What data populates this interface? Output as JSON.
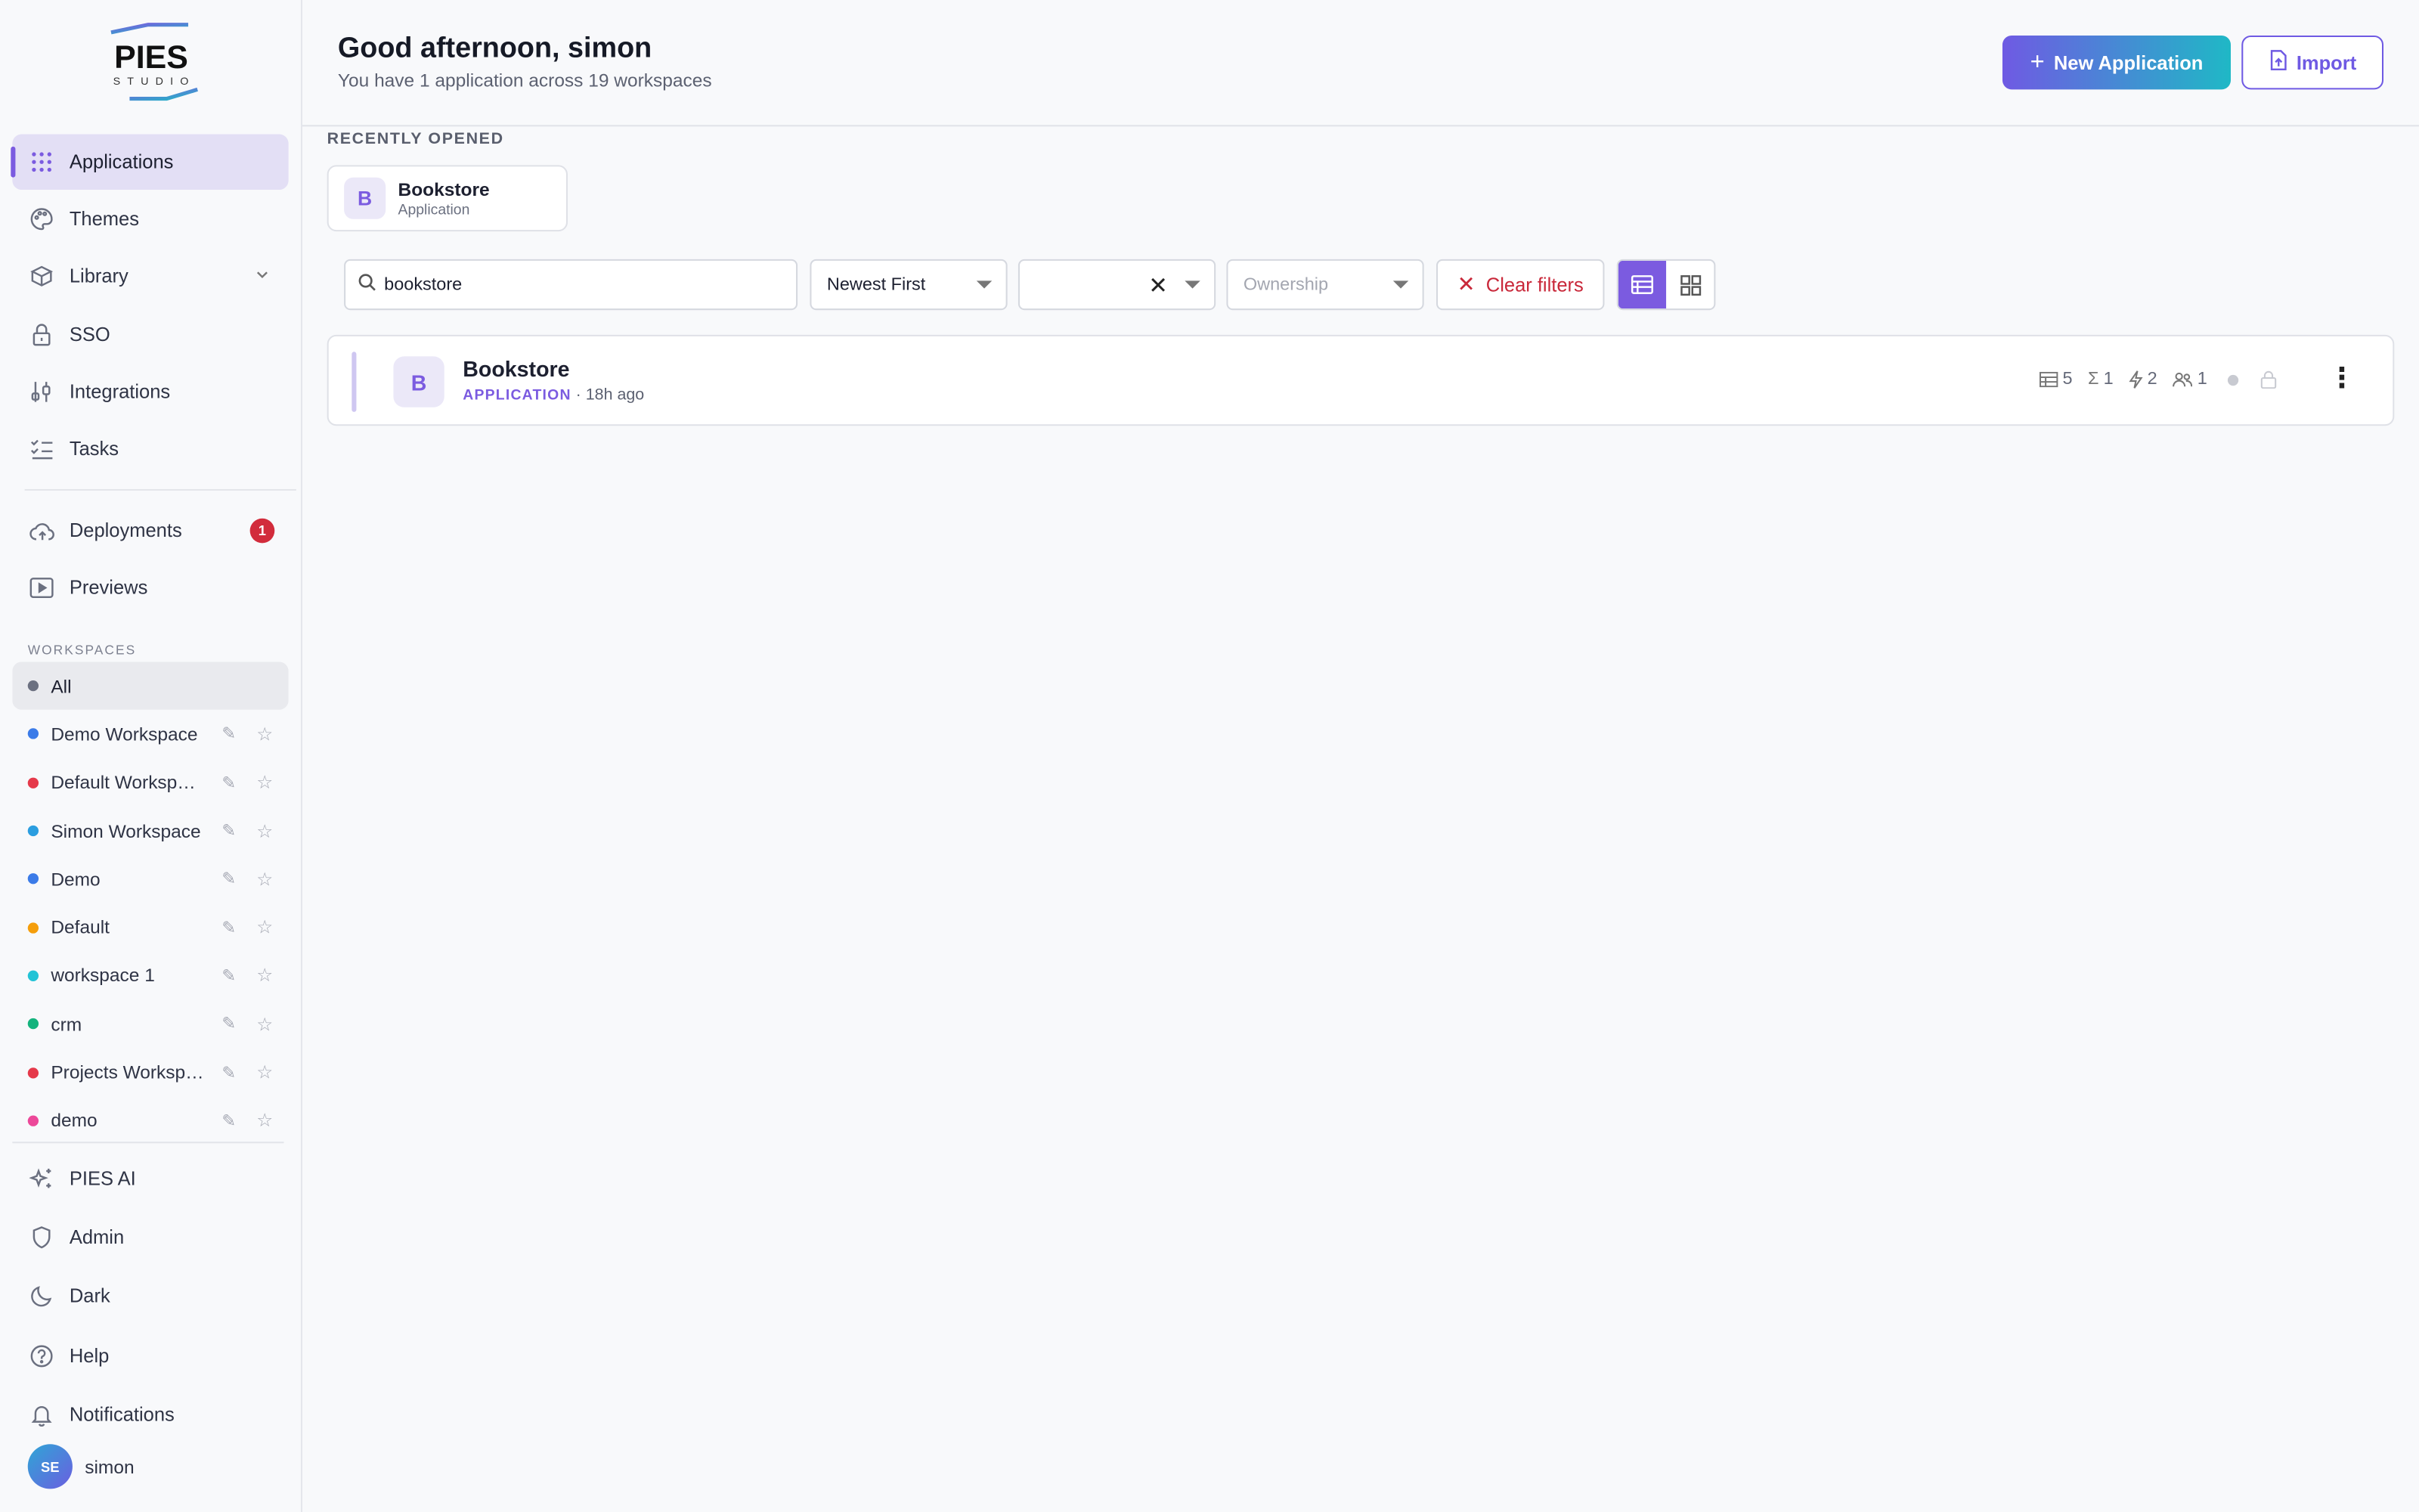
{
  "brand": {
    "name": "PIES",
    "sub": "STUDIO",
    "colors": {
      "primary": "#7b5be0",
      "accent": "#1fb8c6",
      "danger": "#c9283a"
    }
  },
  "sidebar": {
    "nav": [
      {
        "label": "Applications",
        "icon": "grid-icon",
        "active": true
      },
      {
        "label": "Themes",
        "icon": "palette-icon"
      },
      {
        "label": "Library",
        "icon": "library-icon",
        "expandable": true
      },
      {
        "label": "SSO",
        "icon": "lock-icon"
      },
      {
        "label": "Integrations",
        "icon": "integrations-icon"
      },
      {
        "label": "Tasks",
        "icon": "tasks-icon"
      }
    ],
    "nav2": [
      {
        "label": "Deployments",
        "icon": "cloud-icon",
        "badge": "1"
      },
      {
        "label": "Previews",
        "icon": "preview-icon"
      }
    ],
    "workspaces_title": "WORKSPACES",
    "workspaces": [
      {
        "name": "All",
        "color": "#6b7080",
        "active": true
      },
      {
        "name": "Demo Workspace",
        "color": "#3b7be8"
      },
      {
        "name": "Default Workspace",
        "color": "#e5394a"
      },
      {
        "name": "Simon Workspace",
        "color": "#2b9ee0"
      },
      {
        "name": "Demo",
        "color": "#3b7be8"
      },
      {
        "name": "Default",
        "color": "#f59e0b"
      },
      {
        "name": "workspace 1",
        "color": "#22c3d6"
      },
      {
        "name": "crm",
        "color": "#14b37d"
      },
      {
        "name": "Projects Workspace",
        "color": "#e5394a"
      },
      {
        "name": "demo",
        "color": "#ec4899"
      }
    ],
    "bottom": [
      {
        "label": "PIES AI",
        "icon": "sparkle-icon"
      },
      {
        "label": "Admin",
        "icon": "shield-icon"
      },
      {
        "label": "Dark",
        "icon": "moon-icon"
      },
      {
        "label": "Help",
        "icon": "help-icon"
      },
      {
        "label": "Notifications",
        "icon": "bell-icon"
      }
    ],
    "user": {
      "initials": "SE",
      "name": "simon"
    }
  },
  "header": {
    "greeting": "Good afternoon, simon",
    "subtitle": "You have 1 application across 19 workspaces",
    "new_button": "New Application",
    "import_button": "Import"
  },
  "recent": {
    "label": "RECENTLY OPENED",
    "items": [
      {
        "initial": "B",
        "name": "Bookstore",
        "type": "Application"
      }
    ]
  },
  "filters": {
    "search_value": "bookstore",
    "sort": "Newest First",
    "second_select": "",
    "ownership_placeholder": "Ownership",
    "clear_label": "Clear filters",
    "view": "list"
  },
  "apps": [
    {
      "initial": "B",
      "name": "Bookstore",
      "type": "APPLICATION",
      "time": "· 18h ago",
      "stats": {
        "tables": "5",
        "formulas": "1",
        "actions": "2",
        "users": "1"
      }
    }
  ]
}
